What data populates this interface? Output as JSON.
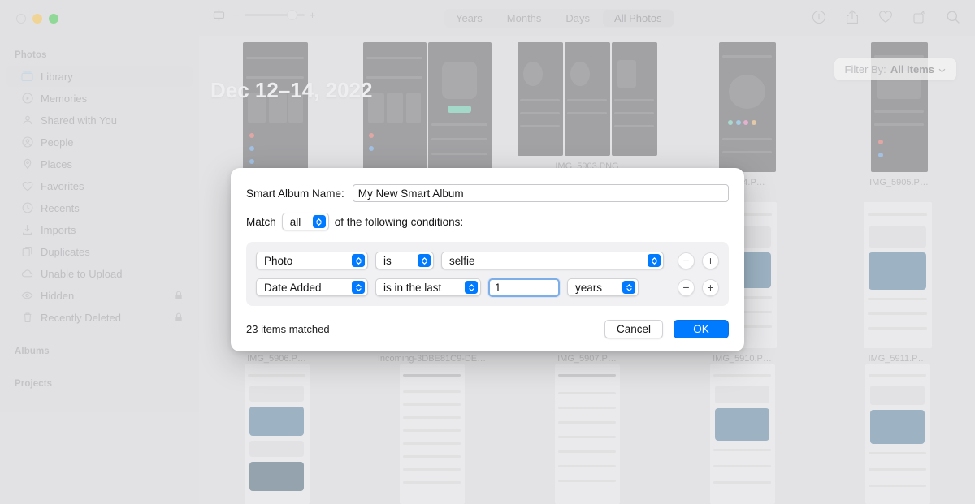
{
  "window": {
    "traffic_lights": [
      "close",
      "minimize",
      "maximize"
    ]
  },
  "toolbar": {
    "zoom_minus": "−",
    "zoom_plus": "+",
    "segments": [
      {
        "label": "Years",
        "active": false
      },
      {
        "label": "Months",
        "active": false
      },
      {
        "label": "Days",
        "active": false
      },
      {
        "label": "All Photos",
        "active": true
      }
    ],
    "icons": [
      "info-icon",
      "share-icon",
      "heart-icon",
      "rotate-icon",
      "search-icon"
    ]
  },
  "sidebar": {
    "section_photos": "Photos",
    "items": [
      {
        "label": "Library",
        "icon": "library-icon",
        "selected": true,
        "locked": false
      },
      {
        "label": "Memories",
        "icon": "memories-icon",
        "selected": false,
        "locked": false
      },
      {
        "label": "Shared with You",
        "icon": "shared-icon",
        "selected": false,
        "locked": false
      },
      {
        "label": "People",
        "icon": "people-icon",
        "selected": false,
        "locked": false
      },
      {
        "label": "Places",
        "icon": "places-icon",
        "selected": false,
        "locked": false
      },
      {
        "label": "Favorites",
        "icon": "heart-icon",
        "selected": false,
        "locked": false
      },
      {
        "label": "Recents",
        "icon": "clock-icon",
        "selected": false,
        "locked": false
      },
      {
        "label": "Imports",
        "icon": "import-icon",
        "selected": false,
        "locked": false
      },
      {
        "label": "Duplicates",
        "icon": "duplicates-icon",
        "selected": false,
        "locked": false
      },
      {
        "label": "Unable to Upload",
        "icon": "cloud-icon",
        "selected": false,
        "locked": false
      },
      {
        "label": "Hidden",
        "icon": "eye-slash-icon",
        "selected": false,
        "locked": true
      },
      {
        "label": "Recently Deleted",
        "icon": "trash-icon",
        "selected": false,
        "locked": true
      }
    ],
    "section_albums": "Albums",
    "section_projects": "Projects"
  },
  "content": {
    "date_header": "Dec 12–14, 2022",
    "filter_label": "Filter By:",
    "filter_value": "All Items",
    "rows": [
      {
        "cells": [
          {
            "caption": "",
            "thumbs": 1,
            "tone": "dark"
          },
          {
            "caption": "",
            "thumbs": 2,
            "tone": "dark"
          },
          {
            "caption": "IMG_5903.PNG",
            "thumbs": 3,
            "tone": "dark"
          },
          {
            "caption": "…04.P…",
            "thumbs": 1,
            "tone": "dark"
          },
          {
            "caption": "IMG_5905.P…",
            "thumbs": 1,
            "tone": "dark"
          }
        ]
      },
      {
        "cells": [
          {
            "caption": "IMG_5906.P…",
            "thumbs": 1,
            "tone": "dark"
          },
          {
            "caption": "Incoming-3DBE81C9-DE…",
            "thumbs": 1,
            "tone": "dark"
          },
          {
            "caption": "IMG_5907.P…",
            "thumbs": 1,
            "tone": "dark"
          },
          {
            "caption": "IMG_5910.P…",
            "thumbs": 1,
            "tone": "light"
          },
          {
            "caption": "IMG_5911.P…",
            "thumbs": 1,
            "tone": "light"
          }
        ]
      },
      {
        "cells": [
          {
            "caption": "",
            "thumbs": 1,
            "tone": "light"
          },
          {
            "caption": "",
            "thumbs": 1,
            "tone": "light"
          },
          {
            "caption": "",
            "thumbs": 1,
            "tone": "light"
          },
          {
            "caption": "",
            "thumbs": 1,
            "tone": "light"
          },
          {
            "caption": "",
            "thumbs": 1,
            "tone": "light"
          }
        ]
      }
    ]
  },
  "dialog": {
    "name_label": "Smart Album Name:",
    "name_value": "My New Smart Album",
    "match_prefix": "Match",
    "match_value": "all",
    "match_suffix": "of the following conditions:",
    "conditions": [
      {
        "attribute": "Photo",
        "operator": "is",
        "value": "selfie",
        "unit": null,
        "value_type": "popup",
        "remove_label": "−",
        "add_label": "+"
      },
      {
        "attribute": "Date Added",
        "operator": "is in the last",
        "value": "1",
        "unit": "years",
        "value_type": "text",
        "remove_label": "−",
        "add_label": "+"
      }
    ],
    "matched_text": "23 items matched",
    "cancel_label": "Cancel",
    "ok_label": "OK"
  },
  "colors": {
    "accent": "#007aff",
    "window_chrome": "#d6d6d8",
    "dialog_bg": "#ffffff",
    "conditions_bg": "#f1f1f3",
    "focus_ring": "#7eaee8"
  }
}
